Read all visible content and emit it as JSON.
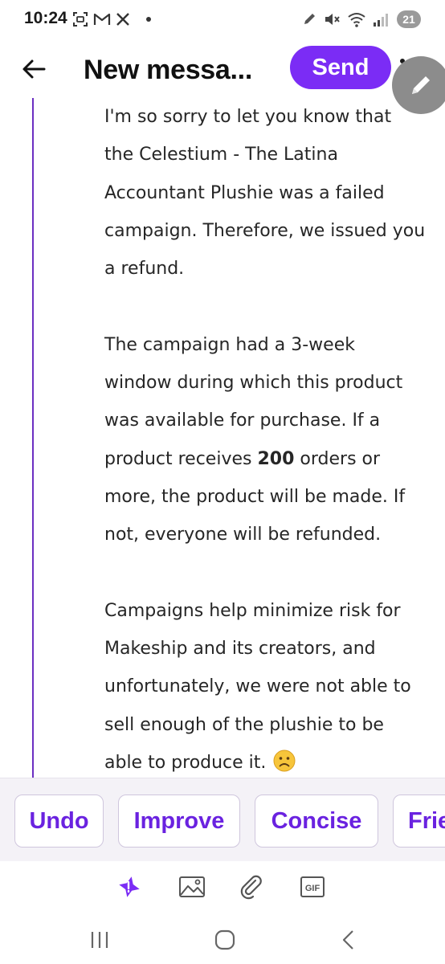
{
  "status_bar": {
    "time": "10:24",
    "left_icons": [
      "screenshot-icon",
      "gmail-icon",
      "x-icon",
      "notification-dot"
    ],
    "right_icons": [
      "pen-icon",
      "mute-icon",
      "wifi-icon",
      "signal-icon"
    ],
    "battery": "21"
  },
  "header": {
    "title": "New messa...",
    "send_label": "Send",
    "accent_color": "#7b2cf5"
  },
  "message": {
    "paragraphs": [
      {
        "text": "I'm so sorry to let you know that the Celestium - The Latina Accountant Plushie was a failed campaign. Therefore, we issued you a refund."
      },
      {
        "before": "The campaign had a 3-week window during which this product was available for purchase. If a product receives ",
        "bold": "200",
        "after": " orders or more, the product will be made. If not, everyone will be refunded."
      },
      {
        "text": "Campaigns help minimize risk for Makeship and its creators, and unfortunately, we were not able to sell enough of the plushie to be able to produce it.",
        "trailing_icon": "slightly-frowning-face-emoji"
      }
    ]
  },
  "suggestions": {
    "chips": [
      "Undo",
      "Improve",
      "Concise",
      "Frie"
    ]
  },
  "toolbar": {
    "icons": [
      "ai-sparkle-icon",
      "image-icon",
      "paperclip-icon",
      "gif-icon"
    ],
    "gif_label": "GIF"
  },
  "nav": {
    "buttons": [
      "recents-icon",
      "home-icon",
      "back-icon"
    ]
  }
}
